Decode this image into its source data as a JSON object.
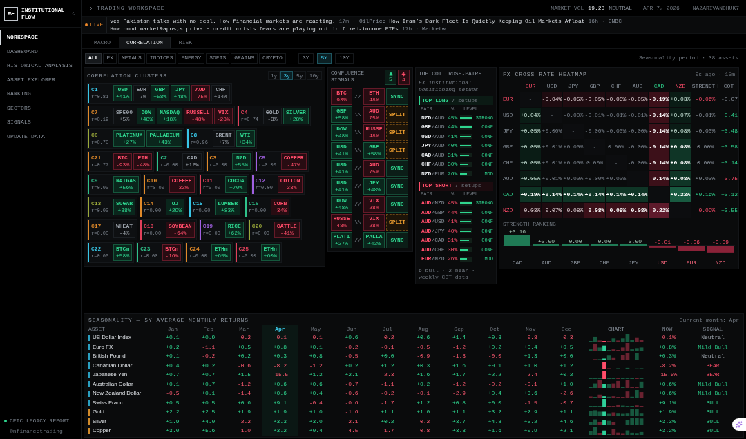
{
  "sidebar": {
    "logo_mark": "NF",
    "brand": "INSTITUTIONAL FLOW",
    "nav": [
      {
        "label": "WORKSPACE",
        "selected": true
      },
      {
        "label": "DASHBOARD",
        "selected": false
      },
      {
        "label": "HISTORICAL ANALYSIS",
        "selected": false
      },
      {
        "label": "ASSET EXPLORER",
        "selected": false
      },
      {
        "label": "RANKING",
        "selected": false
      },
      {
        "label": "SECTORS",
        "selected": false
      },
      {
        "label": "SIGNALS",
        "selected": false
      },
      {
        "label": "UPDATE DATA",
        "selected": false
      }
    ],
    "footer_title": "CFTC LEGACY REPORT",
    "footer_handle": "@nfinancetrading"
  },
  "header": {
    "breadcrumb": "TRADING WORKSPACE",
    "market_vol_label": "MARKET VOL",
    "market_vol_value": "19.23",
    "market_state": "NEUTRAL",
    "date": "APR 7, 2026",
    "user": "NAZARIVANCHUK7"
  },
  "ticker": {
    "live_label": "LIVE",
    "segments": [
      {
        "kind": "headline",
        "text": "ves Pakistan talks with no deal. How financial markets are reacting."
      },
      {
        "kind": "age",
        "text": "17m"
      },
      {
        "kind": "sep",
        "text": "·"
      },
      {
        "kind": "source",
        "text": "OilPrice"
      },
      {
        "kind": "headline",
        "text": "How Iran’s Dark Fleet Is Quietly Keeping Oil Markets Afloat"
      },
      {
        "kind": "age",
        "text": "16h"
      },
      {
        "kind": "sep",
        "text": "·"
      },
      {
        "kind": "source",
        "text": "CNBC"
      },
      {
        "kind": "headline",
        "text": "How bond market&apos;s private credit crisis fears are playing out in fixed-income ETFs"
      },
      {
        "kind": "age",
        "text": "17h"
      },
      {
        "kind": "sep",
        "text": "·"
      },
      {
        "kind": "source",
        "text": "Marketw"
      }
    ]
  },
  "view_tabs": [
    {
      "label": "MACRO",
      "selected": false
    },
    {
      "label": "CORRELATION",
      "selected": true
    },
    {
      "label": "RISK",
      "selected": false
    }
  ],
  "asset_filters": [
    {
      "label": "ALL",
      "selected": true
    },
    {
      "label": "FX",
      "selected": false
    },
    {
      "label": "METALS",
      "selected": false
    },
    {
      "label": "INDICES",
      "selected": false
    },
    {
      "label": "ENERGY",
      "selected": false
    },
    {
      "label": "SOFTS",
      "selected": false
    },
    {
      "label": "GRAINS",
      "selected": false
    },
    {
      "label": "CRYPTO",
      "selected": false
    }
  ],
  "period_filters": [
    {
      "label": "3Y",
      "selected": false
    },
    {
      "label": "5Y",
      "selected": true
    },
    {
      "label": "10Y",
      "selected": false
    }
  ],
  "filter_note": "Seasonality period · 38 assets",
  "clusters_panel": {
    "title": "CORRELATION CLUSTERS",
    "periods": [
      {
        "label": "1y",
        "selected": false
      },
      {
        "label": "3y",
        "selected": true
      },
      {
        "label": "5y",
        "selected": false
      },
      {
        "label": "10y",
        "selected": false
      }
    ],
    "clusters": [
      {
        "id": "C1",
        "color": "#38c6e6",
        "r": "r=0.81",
        "assets": [
          {
            "name": "USD",
            "pct": "+41%",
            "kind": "bull"
          },
          {
            "name": "EUR",
            "pct": "-7%",
            "kind": "neutral"
          },
          {
            "name": "GBP",
            "pct": "+58%",
            "kind": "bull"
          },
          {
            "name": "JPY",
            "pct": "+48%",
            "kind": "bull"
          },
          {
            "name": "AUD",
            "pct": "-75%",
            "kind": "bear"
          },
          {
            "name": "CHF",
            "pct": "+14%",
            "kind": "neutral"
          }
        ]
      },
      {
        "id": "C7",
        "color": "#e08a2a",
        "r": "r=0.19",
        "assets": [
          {
            "name": "SP500",
            "pct": "+5%",
            "kind": "neutral"
          },
          {
            "name": "DOW",
            "pct": "+48%",
            "kind": "bull"
          },
          {
            "name": "NASDAQ",
            "pct": "+18%",
            "kind": "bull"
          },
          {
            "name": "RUSSELL",
            "pct": "-48%",
            "kind": "bear"
          },
          {
            "name": "VIX",
            "pct": "-28%",
            "kind": "bear"
          }
        ]
      },
      {
        "id": "C4",
        "color": "#e0405a",
        "r": "r=0.74",
        "assets": [
          {
            "name": "GOLD",
            "pct": "-3%",
            "kind": "neutral"
          },
          {
            "name": "SILVER",
            "pct": "+28%",
            "kind": "bull"
          }
        ]
      },
      {
        "id": "C6",
        "color": "#9aa83a",
        "r": "r=0.70",
        "assets": [
          {
            "name": "PLATINUM",
            "pct": "+27%",
            "kind": "bull"
          },
          {
            "name": "PALLADIUM",
            "pct": "+43%",
            "kind": "bull"
          }
        ]
      },
      {
        "id": "C8",
        "color": "#38c6e6",
        "r": "r=0.96",
        "assets": [
          {
            "name": "BRENT",
            "pct": "+7%",
            "kind": "neutral"
          },
          {
            "name": "WTI",
            "pct": "+34%",
            "kind": "bull"
          }
        ]
      },
      {
        "id": "C21",
        "color": "#e08a2a",
        "r": "r=0.77",
        "assets": [
          {
            "name": "BTC",
            "pct": "-93%",
            "kind": "bear"
          },
          {
            "name": "ETH",
            "pct": "-48%",
            "kind": "bear"
          }
        ]
      },
      {
        "id": "C2",
        "color": "#2fc08a",
        "r": "r=0.00",
        "assets": [
          {
            "name": "CAD",
            "pct": "+12%",
            "kind": "neutral"
          }
        ]
      },
      {
        "id": "C3",
        "color": "#e08a2a",
        "r": "r=0.00",
        "assets": [
          {
            "name": "NZD",
            "pct": "+55%",
            "kind": "bull"
          }
        ]
      },
      {
        "id": "C5",
        "color": "#a060e0",
        "r": "r=0.00",
        "assets": [
          {
            "name": "COPPER",
            "pct": "-47%",
            "kind": "bear"
          }
        ]
      },
      {
        "id": "C9",
        "color": "#2fc08a",
        "r": "r=0.00",
        "assets": [
          {
            "name": "NATGAS",
            "pct": "+56%",
            "kind": "bull"
          }
        ]
      },
      {
        "id": "C10",
        "color": "#e08a2a",
        "r": "r=0.00",
        "assets": [
          {
            "name": "COFFEE",
            "pct": "-33%",
            "kind": "bear"
          }
        ]
      },
      {
        "id": "C11",
        "color": "#e0405a",
        "r": "r=0.00",
        "assets": [
          {
            "name": "COCOA",
            "pct": "+70%",
            "kind": "bull"
          }
        ]
      },
      {
        "id": "C12",
        "color": "#a060e0",
        "r": "r=0.00",
        "assets": [
          {
            "name": "COTTON",
            "pct": "-33%",
            "kind": "bear"
          }
        ]
      },
      {
        "id": "C13",
        "color": "#9aa83a",
        "r": "r=0.00",
        "assets": [
          {
            "name": "SUGAR",
            "pct": "+38%",
            "kind": "bull"
          }
        ]
      },
      {
        "id": "C14",
        "color": "#e08a2a",
        "r": "r=0.00",
        "assets": [
          {
            "name": "OJ",
            "pct": "+29%",
            "kind": "bull"
          }
        ]
      },
      {
        "id": "C15",
        "color": "#38c6e6",
        "r": "r=0.00",
        "assets": [
          {
            "name": "LUMBER",
            "pct": "+83%",
            "kind": "bull"
          }
        ]
      },
      {
        "id": "C16",
        "color": "#2fc08a",
        "r": "r=0.00",
        "assets": [
          {
            "name": "CORN",
            "pct": "-34%",
            "kind": "bear"
          }
        ]
      },
      {
        "id": "C17",
        "color": "#e08a2a",
        "r": "r=0.00",
        "assets": [
          {
            "name": "WHEAT",
            "pct": "-4%",
            "kind": "neutral"
          }
        ]
      },
      {
        "id": "C18",
        "color": "#e0405a",
        "r": "r=0.00",
        "assets": [
          {
            "name": "SOYBEAN",
            "pct": "-64%",
            "kind": "bear"
          }
        ]
      },
      {
        "id": "C19",
        "color": "#a060e0",
        "r": "r=0.00",
        "assets": [
          {
            "name": "RICE",
            "pct": "+62%",
            "kind": "bull"
          }
        ]
      },
      {
        "id": "C20",
        "color": "#9aa83a",
        "r": "r=0.00",
        "assets": [
          {
            "name": "CATTLE",
            "pct": "-41%",
            "kind": "bear"
          }
        ]
      },
      {
        "id": "C22",
        "color": "#38c6e6",
        "r": "r=0.00",
        "assets": [
          {
            "name": "BTCm",
            "pct": "+58%",
            "kind": "bull"
          }
        ]
      },
      {
        "id": "C23",
        "color": "#2fc08a",
        "r": "r=0.00",
        "assets": [
          {
            "name": "BTCn",
            "pct": "-16%",
            "kind": "bear"
          }
        ]
      },
      {
        "id": "C24",
        "color": "#e08a2a",
        "r": "r=0.00",
        "assets": [
          {
            "name": "ETHm",
            "pct": "+65%",
            "kind": "bull"
          }
        ]
      },
      {
        "id": "C25",
        "color": "#e0405a",
        "r": "r=0.00",
        "assets": [
          {
            "name": "ETHn",
            "pct": "+60%",
            "kind": "bull"
          }
        ]
      }
    ]
  },
  "confluence": {
    "title": "CONFLUENCE SIGNALS",
    "bull_count": "5",
    "bear_count": "4",
    "rows": [
      {
        "left": {
          "name": "BTC",
          "pct": "93%",
          "kind": "bear"
        },
        "link": "//",
        "right": {
          "name": "ETH",
          "pct": "48%",
          "kind": "bear"
        },
        "signal": {
          "kind": "sync",
          "text": "SYNC"
        }
      },
      {
        "left": {
          "name": "GBP",
          "pct": "+58%",
          "kind": "bull"
        },
        "link": "\\\\",
        "right": {
          "name": "AUD",
          "pct": "75%",
          "kind": "bear"
        },
        "signal": {
          "kind": "split",
          "text": "SPLIT"
        }
      },
      {
        "left": {
          "name": "DOW",
          "pct": "+48%",
          "kind": "bull"
        },
        "link": "\\\\",
        "right": {
          "name": "RUSSE",
          "pct": "48%",
          "kind": "bear"
        },
        "signal": {
          "kind": "split",
          "text": "SPLIT"
        }
      },
      {
        "left": {
          "name": "USD",
          "pct": "+41%",
          "kind": "bull"
        },
        "link": "\\\\",
        "right": {
          "name": "GBP",
          "pct": "+58%",
          "kind": "bull"
        },
        "signal": {
          "kind": "split",
          "text": "SPLIT"
        }
      },
      {
        "left": {
          "name": "USD",
          "pct": "+41%",
          "kind": "bull"
        },
        "link": "//",
        "right": {
          "name": "AUD",
          "pct": "75%",
          "kind": "bear"
        },
        "signal": {
          "kind": "sync",
          "text": "SYNC"
        }
      },
      {
        "left": {
          "name": "USD",
          "pct": "+41%",
          "kind": "bull"
        },
        "link": "//",
        "right": {
          "name": "JPY",
          "pct": "+48%",
          "kind": "bull"
        },
        "signal": {
          "kind": "sync",
          "text": "SYNC"
        }
      },
      {
        "left": {
          "name": "DOW",
          "pct": "+48%",
          "kind": "bull"
        },
        "link": "//",
        "right": {
          "name": "VIX",
          "pct": "28%",
          "kind": "bear"
        },
        "signal": {
          "kind": "sync",
          "text": "SYNC"
        }
      },
      {
        "left": {
          "name": "RUSSE",
          "pct": "48%",
          "kind": "bear"
        },
        "link": "\\\\",
        "right": {
          "name": "VIX",
          "pct": "28%",
          "kind": "bear"
        },
        "signal": {
          "kind": "split",
          "text": "SPLIT"
        }
      },
      {
        "left": {
          "name": "PLATI",
          "pct": "+27%",
          "kind": "bull"
        },
        "link": "//",
        "right": {
          "name": "PALLA",
          "pct": "+43%",
          "kind": "bull"
        },
        "signal": {
          "kind": "sync",
          "text": "SYNC"
        }
      }
    ]
  },
  "cot": {
    "title": "TOP COT CROSS-PAIRS",
    "subtitle": "FX institutional positioning setups",
    "sections": [
      {
        "kind": "long",
        "title": "TOP LONG",
        "count": "7 setups",
        "columns": [
          "PAIR",
          "%",
          "LEVEL"
        ],
        "rows": [
          {
            "pair": "**NZD**/AUD",
            "pct": "45%",
            "level": 1,
            "grade": "STRONG"
          },
          {
            "pair": "**GBP**/AUD",
            "pct": "44%",
            "level": 0.95,
            "grade": "CONF"
          },
          {
            "pair": "**USD**/AUD",
            "pct": "41%",
            "level": 0.9,
            "grade": "CONF"
          },
          {
            "pair": "**JPY**/AUD",
            "pct": "40%",
            "level": 0.9,
            "grade": "CONF"
          },
          {
            "pair": "**CAD**/AUD",
            "pct": "31%",
            "level": 0.7,
            "grade": "CONF"
          },
          {
            "pair": "**CHF**/AUD",
            "pct": "30%",
            "level": 0.65,
            "grade": "CONF"
          },
          {
            "pair": "**NZD**/EUR",
            "pct": "26%",
            "level": 0.55,
            "grade": "MOD"
          }
        ]
      },
      {
        "kind": "short",
        "title": "TOP SHORT",
        "count": "7 setups",
        "columns": [
          "PAIR",
          "%",
          "LEVEL"
        ],
        "rows": [
          {
            "pair": "**AUD**/NZD",
            "pct": "45%",
            "level": 1,
            "grade": "STRONG"
          },
          {
            "pair": "**AUD**/GBP",
            "pct": "44%",
            "level": 0.95,
            "grade": "CONF"
          },
          {
            "pair": "**AUD**/USD",
            "pct": "41%",
            "level": 0.9,
            "grade": "CONF"
          },
          {
            "pair": "**AUD**/JPY",
            "pct": "40%",
            "level": 0.9,
            "grade": "CONF"
          },
          {
            "pair": "**AUD**/CAD",
            "pct": "31%",
            "level": 0.7,
            "grade": "CONF"
          },
          {
            "pair": "**AUD**/CHF",
            "pct": "30%",
            "level": 0.65,
            "grade": "CONF"
          },
          {
            "pair": "**EUR**/NZD",
            "pct": "26%",
            "level": 0.55,
            "grade": "MOD"
          }
        ]
      }
    ],
    "footer": "6 bull · 2 bear · weekly COT data"
  },
  "heatmap": {
    "title": "FX CROSS-RATE HEATMAP",
    "status": "0s ago · 15m",
    "columns": [
      {
        "label": "EUR",
        "kind": "bear"
      },
      {
        "label": "USD",
        "kind": "flat"
      },
      {
        "label": "JPY",
        "kind": "flat"
      },
      {
        "label": "GBP",
        "kind": "flat"
      },
      {
        "label": "CHF",
        "kind": "flat"
      },
      {
        "label": "AUD",
        "kind": "flat"
      },
      {
        "label": "CAD",
        "kind": "bull"
      },
      {
        "label": "NZD",
        "kind": "bear"
      },
      {
        "label": "STRENGTH",
        "kind": "flat"
      },
      {
        "label": "COT",
        "kind": "flat"
      }
    ],
    "rows": [
      {
        "label": "EUR",
        "kind": "bear",
        "cells": [
          {
            "value": "-",
            "kind": "none"
          },
          {
            "value": "-0.04%",
            "kind": "bear"
          },
          {
            "value": "-0.05%",
            "kind": "bear"
          },
          {
            "value": "-0.05%",
            "kind": "bear"
          },
          {
            "value": "-0.05%",
            "kind": "bear"
          },
          {
            "value": "-0.05%",
            "kind": "bear"
          },
          {
            "value": "-0.19%",
            "kind": "bear2"
          },
          {
            "value": "+0.03%",
            "kind": "bull"
          }
        ],
        "strength": {
          "value": "-0.06%",
          "kind": "bear"
        },
        "cot": {
          "value": "-0.07",
          "kind": "flat"
        }
      },
      {
        "label": "USD",
        "kind": "flat",
        "cells": [
          {
            "value": "+0.04%",
            "kind": "bull"
          },
          {
            "value": "-",
            "kind": "none"
          },
          {
            "value": "-0.00%",
            "kind": "flat"
          },
          {
            "value": "-0.01%",
            "kind": "flat"
          },
          {
            "value": "-0.01%",
            "kind": "flat"
          },
          {
            "value": "-0.01%",
            "kind": "flat"
          },
          {
            "value": "-0.14%",
            "kind": "bear2"
          },
          {
            "value": "+0.07%",
            "kind": "bull"
          }
        ],
        "strength": {
          "value": "-0.01%",
          "kind": "flat"
        },
        "cot": {
          "value": "+0.41",
          "kind": "bull"
        }
      },
      {
        "label": "JPY",
        "kind": "flat",
        "cells": [
          {
            "value": "+0.05%",
            "kind": "bull"
          },
          {
            "value": "+0.00%",
            "kind": "flat"
          },
          {
            "value": "-",
            "kind": "none"
          },
          {
            "value": "-0.00%",
            "kind": "flat"
          },
          {
            "value": "-0.00%",
            "kind": "flat"
          },
          {
            "value": "-0.00%",
            "kind": "flat"
          },
          {
            "value": "-0.14%",
            "kind": "bear2"
          },
          {
            "value": "+0.08%",
            "kind": "bull"
          }
        ],
        "strength": {
          "value": "-0.00%",
          "kind": "flat"
        },
        "cot": {
          "value": "+0.48",
          "kind": "bull"
        }
      },
      {
        "label": "GBP",
        "kind": "flat",
        "cells": [
          {
            "value": "+0.05%",
            "kind": "bull"
          },
          {
            "value": "+0.01%",
            "kind": "flat"
          },
          {
            "value": "+0.00%",
            "kind": "flat"
          },
          {
            "value": "-",
            "kind": "none"
          },
          {
            "value": "0.00%",
            "kind": "flat"
          },
          {
            "value": "-0.00%",
            "kind": "flat"
          },
          {
            "value": "-0.14%",
            "kind": "bear2"
          },
          {
            "value": "+0.08%",
            "kind": "bull2"
          }
        ],
        "strength": {
          "value": "0.00%",
          "kind": "flat"
        },
        "cot": {
          "value": "+0.58",
          "kind": "bull"
        }
      },
      {
        "label": "CHF",
        "kind": "flat",
        "cells": [
          {
            "value": "+0.05%",
            "kind": "bull"
          },
          {
            "value": "+0.01%",
            "kind": "flat"
          },
          {
            "value": "+0.00%",
            "kind": "flat"
          },
          {
            "value": "0.00%",
            "kind": "flat"
          },
          {
            "value": "-",
            "kind": "none"
          },
          {
            "value": "-0.00%",
            "kind": "flat"
          },
          {
            "value": "-0.14%",
            "kind": "bear2"
          },
          {
            "value": "+0.08%",
            "kind": "bull2"
          }
        ],
        "strength": {
          "value": "0.00%",
          "kind": "flat"
        },
        "cot": {
          "value": "+0.14",
          "kind": "bull"
        }
      },
      {
        "label": "AUD",
        "kind": "flat",
        "cells": [
          {
            "value": "+0.05%",
            "kind": "bull"
          },
          {
            "value": "+0.01%",
            "kind": "flat"
          },
          {
            "value": "+0.00%",
            "kind": "flat"
          },
          {
            "value": "+0.00%",
            "kind": "flat"
          },
          {
            "value": "+0.00%",
            "kind": "flat"
          },
          {
            "value": "-",
            "kind": "none"
          },
          {
            "value": "-0.14%",
            "kind": "bear2"
          },
          {
            "value": "+0.08%",
            "kind": "bull2"
          }
        ],
        "strength": {
          "value": "+0.00%",
          "kind": "flat"
        },
        "cot": {
          "value": "-0.75",
          "kind": "bear"
        }
      },
      {
        "label": "CAD",
        "kind": "bull",
        "cells": [
          {
            "value": "+0.19%",
            "kind": "bull2"
          },
          {
            "value": "+0.14%",
            "kind": "bull2"
          },
          {
            "value": "+0.14%",
            "kind": "bull2"
          },
          {
            "value": "+0.14%",
            "kind": "bull2"
          },
          {
            "value": "+0.14%",
            "kind": "bull2"
          },
          {
            "value": "+0.14%",
            "kind": "bull2"
          },
          {
            "value": "-",
            "kind": "none"
          },
          {
            "value": "+0.22%",
            "kind": "bull3"
          }
        ],
        "strength": {
          "value": "+0.16%",
          "kind": "bull"
        },
        "cot": {
          "value": "+0.12",
          "kind": "bull"
        }
      },
      {
        "label": "NZD",
        "kind": "bear",
        "cells": [
          {
            "value": "-0.03%",
            "kind": "bear"
          },
          {
            "value": "-0.07%",
            "kind": "bear"
          },
          {
            "value": "-0.08%",
            "kind": "bear"
          },
          {
            "value": "-0.08%",
            "kind": "bear2"
          },
          {
            "value": "-0.08%",
            "kind": "bear2"
          },
          {
            "value": "-0.08%",
            "kind": "bear2"
          },
          {
            "value": "-0.22%",
            "kind": "bear3"
          },
          {
            "value": "-",
            "kind": "none"
          }
        ],
        "strength": {
          "value": "-0.09%",
          "kind": "bear"
        },
        "cot": {
          "value": "+0.55",
          "kind": "bull"
        }
      }
    ],
    "chart_data": {
      "type": "bar",
      "title": "STRENGTH RANKING",
      "categories": [
        "CAD",
        "AUD",
        "GBP",
        "CHF",
        "JPY",
        "USD",
        "EUR",
        "NZD"
      ],
      "values": [
        0.16,
        0.0,
        0.0,
        0.0,
        0.0,
        -0.01,
        -0.06,
        -0.09
      ],
      "value_labels": [
        "+0.16",
        "+0.00",
        "0.00",
        "0.00",
        "-0.00",
        "-0.01",
        "-0.06",
        "-0.09"
      ]
    }
  },
  "seasonality": {
    "title": "SEASONALITY — 5Y AVERAGE MONTHLY RETURNS",
    "current_month": "Current month: Apr",
    "asset_header": "ASSET",
    "chart_header": "CHART",
    "now_header": "NOW",
    "signal_header": "SIGNAL",
    "months": [
      {
        "label": "Jan",
        "selected": false
      },
      {
        "label": "Feb",
        "selected": false
      },
      {
        "label": "Mar",
        "selected": false
      },
      {
        "label": "Apr",
        "selected": true
      },
      {
        "label": "May",
        "selected": false
      },
      {
        "label": "Jun",
        "selected": false
      },
      {
        "label": "Jul",
        "selected": false
      },
      {
        "label": "Aug",
        "selected": false
      },
      {
        "label": "Sep",
        "selected": false
      },
      {
        "label": "Oct",
        "selected": false
      },
      {
        "label": "Nov",
        "selected": false
      },
      {
        "label": "Dec",
        "selected": false
      }
    ],
    "rows": [
      {
        "asset": "US Dollar Index",
        "color": "#2a9fc0",
        "values": [
          "+0.1",
          "+0.9",
          "-0.2",
          "-0.1",
          "-0.1",
          "+0.6",
          "-0.2",
          "+0.6",
          "+1.4",
          "+0.3",
          "-0.8",
          "-0.3"
        ],
        "now": "-0.1%",
        "signal": {
          "text": "Neutral",
          "kind": "neutral"
        }
      },
      {
        "asset": "Euro FX",
        "color": "#2a9fc0",
        "values": [
          "+0.2",
          "-1.1",
          "+0.5",
          "+0.8",
          "+0.1",
          "-0.2",
          "-0.1",
          "-0.5",
          "-1.2",
          "+0.2",
          "+0.4",
          "+0.5"
        ],
        "now": "+0.8%",
        "signal": {
          "text": "Mild Bull",
          "kind": "mild_bull"
        }
      },
      {
        "asset": "British Pound",
        "color": "#2a9fc0",
        "values": [
          "+0.1",
          "-0.2",
          "+0.2",
          "+0.3",
          "+0.8",
          "-0.5",
          "+0.0",
          "-0.9",
          "-1.3",
          "-0.0",
          "+1.3",
          "+0.0"
        ],
        "now": "+0.3%",
        "signal": {
          "text": "Neutral",
          "kind": "neutral"
        }
      },
      {
        "asset": "Canadian Dollar",
        "color": "#2a9fc0",
        "values": [
          "+0.4",
          "+0.2",
          "-0.6",
          "-8.2",
          "-1.2",
          "+0.2",
          "+1.2",
          "+0.3",
          "+1.6",
          "+0.1",
          "+1.0",
          "+1.2"
        ],
        "now": "-8.2%",
        "signal": {
          "text": "BEAR",
          "kind": "bear"
        }
      },
      {
        "asset": "Japanese Yen",
        "color": "#2a9fc0",
        "values": [
          "+0.7",
          "+0.7",
          "+1.5",
          "-15.5",
          "+1.2",
          "+2.1",
          "-2.3",
          "+1.6",
          "+1.7",
          "+2.2",
          "-2.4",
          "+0.2"
        ],
        "now": "-15.5%",
        "signal": {
          "text": "BEAR",
          "kind": "bear"
        }
      },
      {
        "asset": "Australian Dollar",
        "color": "#2a9fc0",
        "values": [
          "+0.1",
          "+0.7",
          "-1.2",
          "+0.6",
          "+0.6",
          "-0.7",
          "-1.1",
          "+0.2",
          "-1.2",
          "-0.2",
          "-0.1",
          "+1.0"
        ],
        "now": "+0.6%",
        "signal": {
          "text": "Mild Bull",
          "kind": "mild_bull"
        }
      },
      {
        "asset": "New Zealand Dollar",
        "color": "#2a9fc0",
        "values": [
          "-0.5",
          "+0.1",
          "-1.4",
          "+0.6",
          "+0.4",
          "-0.6",
          "-0.2",
          "-0.1",
          "-2.9",
          "+0.4",
          "+3.6",
          "-2.6"
        ],
        "now": "+0.6%",
        "signal": {
          "text": "Mild Bull",
          "kind": "mild_bull"
        }
      },
      {
        "asset": "Swiss Franc",
        "color": "#2a9fc0",
        "values": [
          "+0.5",
          "+0.5",
          "+0.6",
          "+9.1",
          "-0.4",
          "-0.6",
          "-1.7",
          "+1.2",
          "+0.8",
          "+0.0",
          "-1.5",
          "-0.7"
        ],
        "now": "+9.1%",
        "signal": {
          "text": "BULL",
          "kind": "bull"
        }
      },
      {
        "asset": "Gold",
        "color": "#d08a2a",
        "values": [
          "+2.2",
          "+2.5",
          "+1.9",
          "+1.9",
          "+1.0",
          "-1.6",
          "+1.1",
          "+1.0",
          "+1.1",
          "+3.2",
          "+2.9",
          "+1.1"
        ],
        "now": "+1.9%",
        "signal": {
          "text": "BULL",
          "kind": "bull"
        }
      },
      {
        "asset": "Silver",
        "color": "#d08a2a",
        "values": [
          "+1.9",
          "+4.0",
          "-2.2",
          "+3.3",
          "+3.0",
          "-2.1",
          "+0.2",
          "-0.2",
          "+3.7",
          "+4.8",
          "+5.2",
          "+4.6"
        ],
        "now": "+3.3%",
        "signal": {
          "text": "BULL",
          "kind": "bull"
        }
      },
      {
        "asset": "Copper",
        "color": "#d08a2a",
        "values": [
          "+3.0",
          "+5.6",
          "-1.0",
          "+3.2",
          "+0.4",
          "-4.5",
          "-1.7",
          "-0.8",
          "+3.3",
          "+1.6",
          "+0.9",
          "+2.1"
        ],
        "now": "+3.2%",
        "signal": {
          "text": "BULL",
          "kind": "bull"
        }
      }
    ]
  }
}
